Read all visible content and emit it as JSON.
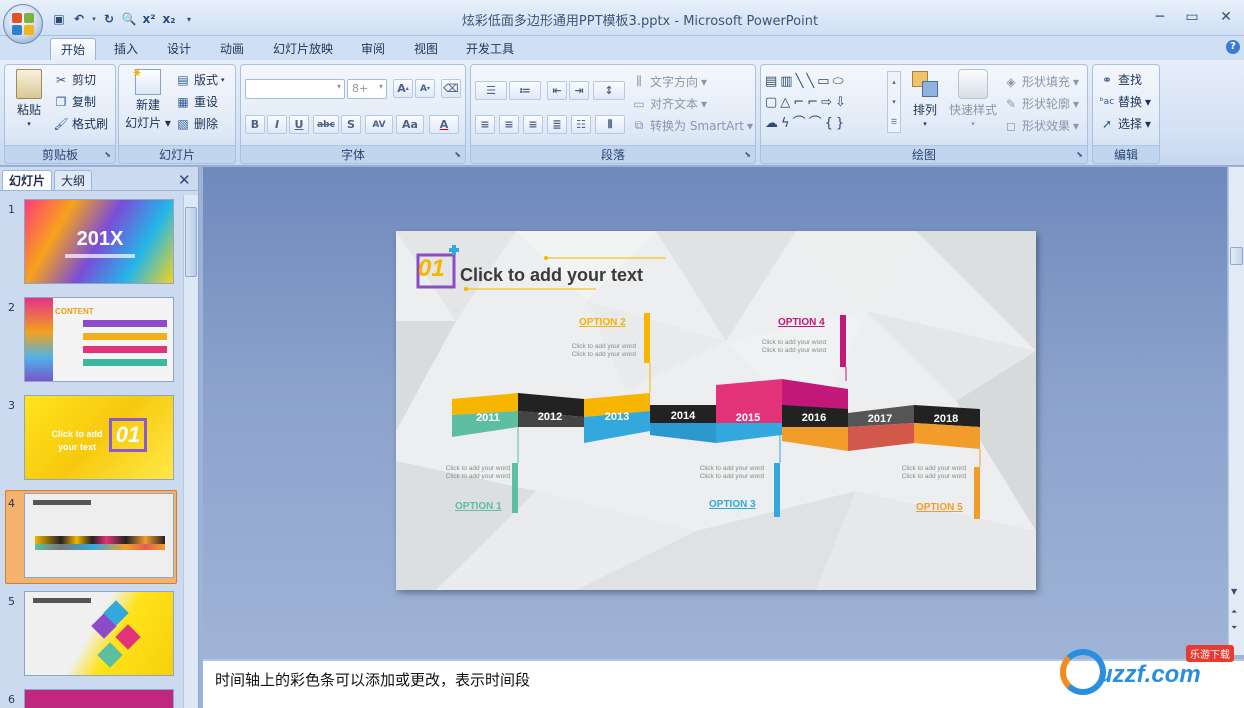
{
  "window": {
    "title": "炫彩低面多边形通用PPT模板3.pptx - Microsoft PowerPoint"
  },
  "tabs": [
    "开始",
    "插入",
    "设计",
    "动画",
    "幻灯片放映",
    "审阅",
    "视图",
    "开发工具"
  ],
  "ribbon": {
    "clipboard": {
      "label": "剪贴板",
      "paste": "粘贴",
      "cut": "剪切",
      "copy": "复制",
      "format_painter": "格式刷"
    },
    "slides": {
      "label": "幻灯片",
      "new_slide": "新建",
      "new_slide2": "幻灯片",
      "layout": "版式",
      "reset": "重设",
      "delete": "删除"
    },
    "font": {
      "label": "字体",
      "font_size": "8+"
    },
    "paragraph": {
      "label": "段落",
      "text_direction": "文字方向",
      "align_text": "对齐文本",
      "smartart": "转换为 SmartArt"
    },
    "drawing": {
      "label": "绘图",
      "arrange": "排列",
      "quick_styles": "快速样式",
      "shape_fill": "形状填充",
      "shape_outline": "形状轮廓",
      "shape_effects": "形状效果"
    },
    "editing": {
      "label": "编辑",
      "find": "查找",
      "replace": "替换",
      "select": "选择"
    }
  },
  "pane": {
    "tab_slides": "幻灯片",
    "tab_outline": "大纲",
    "slides": [
      "1",
      "2",
      "3",
      "4",
      "5",
      "6"
    ],
    "selected": "4"
  },
  "thumbs": {
    "s1_title": "201X",
    "s2_title": "CONTENT",
    "s3_title": "Click to add your text",
    "s3_num": "01"
  },
  "slide": {
    "num": "01",
    "title": "Click to add your text",
    "years": [
      "2011",
      "2012",
      "2013",
      "2014",
      "2015",
      "2016",
      "2017",
      "2018"
    ],
    "options": [
      {
        "label": "OPTION 1",
        "color": "#5dbfa0"
      },
      {
        "label": "OPTION 2",
        "color": "#f5b400"
      },
      {
        "label": "OPTION 3",
        "color": "#33a8dc"
      },
      {
        "label": "OPTION 4",
        "color": "#c2187a"
      },
      {
        "label": "OPTION 5",
        "color": "#f4902a"
      }
    ],
    "small_text": "Click to add your word"
  },
  "notes": {
    "text": "时间轴上的彩色条可以添加或更改，表示时间段"
  },
  "watermark": {
    "text": "uzzf.com",
    "badge": "乐游下载"
  }
}
